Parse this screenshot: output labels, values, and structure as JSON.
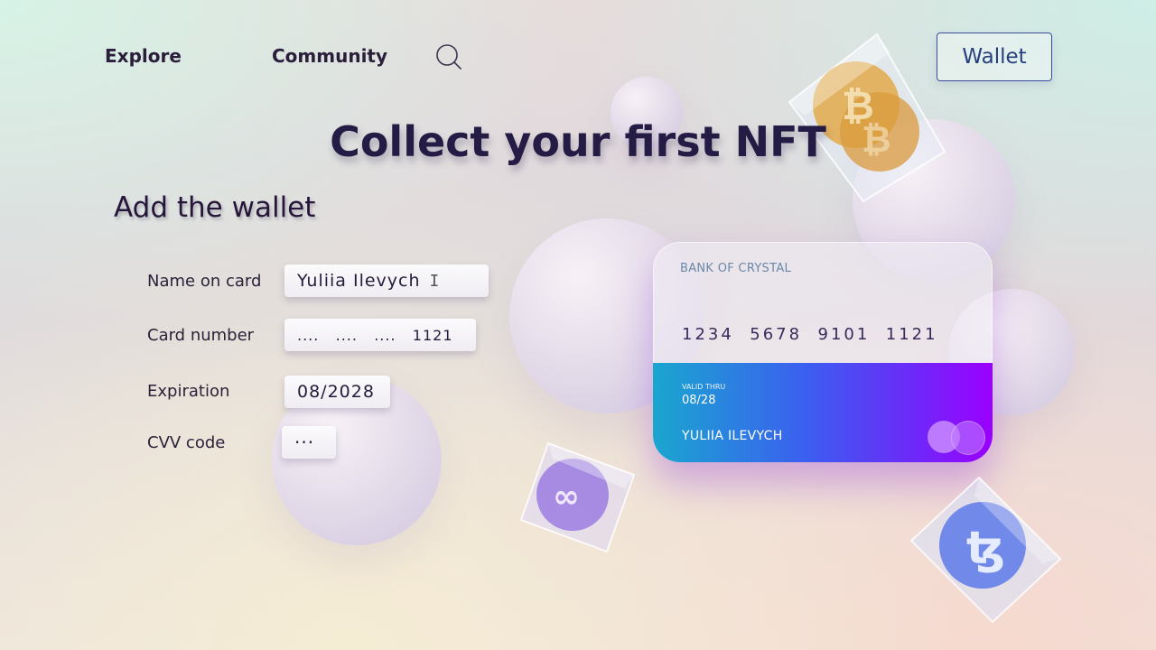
{
  "nav": {
    "explore": "Explore",
    "community": "Community",
    "wallet": "Wallet"
  },
  "hero": {
    "title": "Collect your first NFT"
  },
  "form": {
    "title": "Add the wallet",
    "fields": [
      {
        "label": "Name on card",
        "value": "Yuliia Ilevych"
      },
      {
        "label": "Card number",
        "value": "....   ....   ....   1121"
      },
      {
        "label": "Expiration",
        "value": "08/2028"
      },
      {
        "label": "CVV code",
        "value": "···"
      }
    ]
  },
  "card": {
    "bank": "BANK OF CRYSTAL",
    "number": "1234  5678  9101  1121",
    "valid_label": "VALID THRU",
    "valid_value": "08/28",
    "holder": "YULIIA ILEVYCH"
  },
  "icons": [
    "search-icon",
    "bitcoin-crystal-icon",
    "polygon-crystal-icon",
    "tezos-crystal-icon",
    "card-brand-icon"
  ],
  "colors": {
    "accent": "#3a4f9c",
    "title": "#241c44",
    "card_gradient": [
      "#1aa6cf",
      "#3b5ff0",
      "#6a2cf8",
      "#9b00ff"
    ]
  }
}
